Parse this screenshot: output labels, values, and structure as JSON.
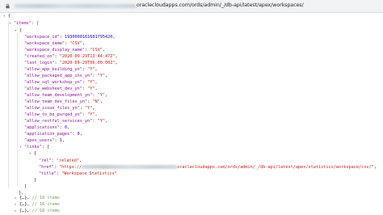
{
  "browser": {
    "url_visible": "oraclecloudapps.com/ords/admin/_/db-api/latest/apex/workspaces/"
  },
  "json": {
    "items_key": "\"items\": [",
    "item0": {
      "workspace_id": "1930000161681795420",
      "workspace_name": "\"CSV\"",
      "workspace_display_name": "\"CSV\"",
      "created_on": "\"2020-09-29T13:44:47Z\"",
      "last_login": "\"2020-09-29T06:00:00Z\"",
      "allow_app_building_yn": "\"Y\"",
      "allow_packaged_app_ins_yn": "\"Y\"",
      "allow_sql_workshop_yn": "\"Y\"",
      "allow_websheet_dev_yn": "\"Y\"",
      "allow_team_development_yn": "\"Y\"",
      "allow_team_dev_files_yn": "\"N\"",
      "allow_issue_files_yn": "\"Y\"",
      "allow_to_be_purged_yn": "\"Y\"",
      "allow_restful_services_yn": "\"Y\"",
      "applications": "0",
      "application_pages": "0",
      "apex_users": "1",
      "links": {
        "rel": "\"related\"",
        "href_tail": "oraclecloudapps.com/ords/admin/_/db-api/latest/apex/statistics/workspace/csv/\"",
        "href_prefix": "\"https://",
        "title": "\"Workspace Statistics\""
      }
    },
    "collapsed_comment": "// 16 items"
  }
}
